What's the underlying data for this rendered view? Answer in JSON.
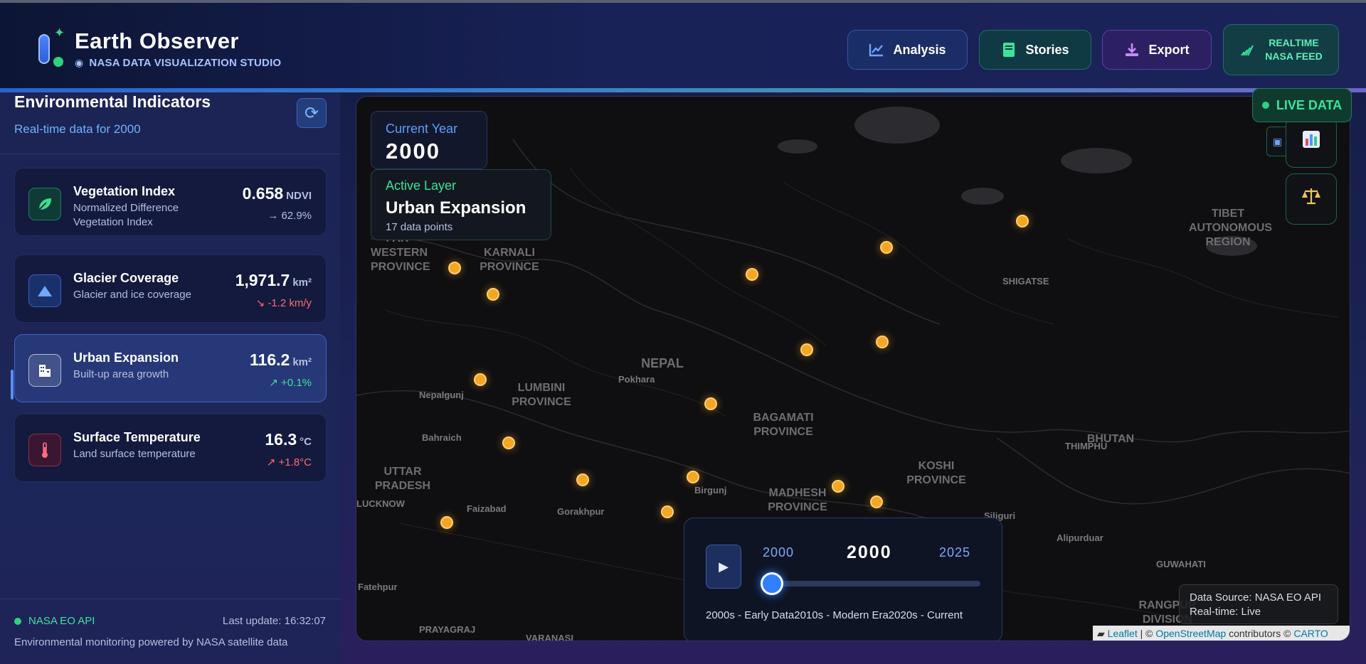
{
  "header": {
    "title": "Earth Observer",
    "subtitle": "NASA DATA VISUALIZATION STUDIO",
    "buttons": {
      "analysis": "Analysis",
      "stories": "Stories",
      "export": "Export",
      "realtime_line1": "REALTIME",
      "realtime_line2": "NASA FEED"
    }
  },
  "sidebar": {
    "title": "Environmental Indicators",
    "subtitle": "Real-time data for 2000",
    "indicators": [
      {
        "name": "Vegetation Index",
        "description": "Normalized Difference Vegetation Index",
        "value": "0.658",
        "unit": "NDVI",
        "trend": "→ 62.9%",
        "icon": "leaf-icon"
      },
      {
        "name": "Glacier Coverage",
        "description": "Glacier and ice coverage",
        "value": "1,971.7",
        "unit": "km²",
        "trend": "↘ -1.2 km/y",
        "icon": "mountain-icon"
      },
      {
        "name": "Urban Expansion",
        "description": "Built-up area growth",
        "value": "116.2",
        "unit": "km²",
        "trend": "↗ +0.1%",
        "icon": "building-icon",
        "active": true
      },
      {
        "name": "Surface Temperature",
        "description": "Land surface temperature",
        "value": "16.3",
        "unit": "°C",
        "trend": "↗ +1.8°C",
        "icon": "thermometer-icon"
      }
    ],
    "footer": {
      "api": "NASA EO API",
      "last_update": "Last update: 16:32:07",
      "note": "Environmental monitoring powered by NASA satellite data"
    }
  },
  "map": {
    "current_year_label": "Current Year",
    "current_year": "2000",
    "active_layer_label": "Active Layer",
    "active_layer": "Urban Expansion",
    "data_points": "17 data points",
    "live_badge": "LIVE DATA",
    "regions": {
      "far_western": "FAR-\nWESTERN\nPROVINCE",
      "karnali": "KARNALI\nPROVINCE",
      "nepal": "NEPAL",
      "lumbini": "LUMBINI\nPROVINCE",
      "bagamati": "BAGAMATI\nPROVINCE",
      "uttar": "UTTAR\nPRADESH",
      "madhesh": "MADHESH\nPROVINCE",
      "koshi": "KOSHI\nPROVINCE",
      "bhutan": "BHUTAN",
      "tibet": "TIBET\nAUTONOMOUS\nREGION",
      "rangpur": "RANGPUR\nDIVISION"
    },
    "cities": {
      "shigatse": "SHIGATSE",
      "pokhara": "Pokhara",
      "nepalgunj": "Nepalgunj",
      "bahraich": "Bahraich",
      "lucknow": "LUCKNOW",
      "faizabad": "Faizabad",
      "gorakhpur": "Gorakhpur",
      "birgunj": "Birgunj",
      "thimphu": "THIMPHU",
      "siliguri": "Siliguri",
      "alipurduar": "Alipurduar",
      "guwahati": "GUWAHATI",
      "fatehpur": "Fatehpur",
      "prayagraj": "PRAYAGRAJ",
      "varanasi": "VARANASI"
    },
    "timeline": {
      "start": "2000",
      "current": "2000",
      "end": "2025",
      "progress": 0,
      "eras": "2000s - Early Data2010s - Modern Era2020s - Current"
    },
    "data_source": {
      "line1": "Data Source: NASA EO API",
      "line2": "Real-time: Live"
    },
    "attribution": {
      "leaflet": "Leaflet",
      "sep": " | © ",
      "osm": "OpenStreetMap",
      "contrib": " contributors © ",
      "carto": "CARTO"
    }
  }
}
